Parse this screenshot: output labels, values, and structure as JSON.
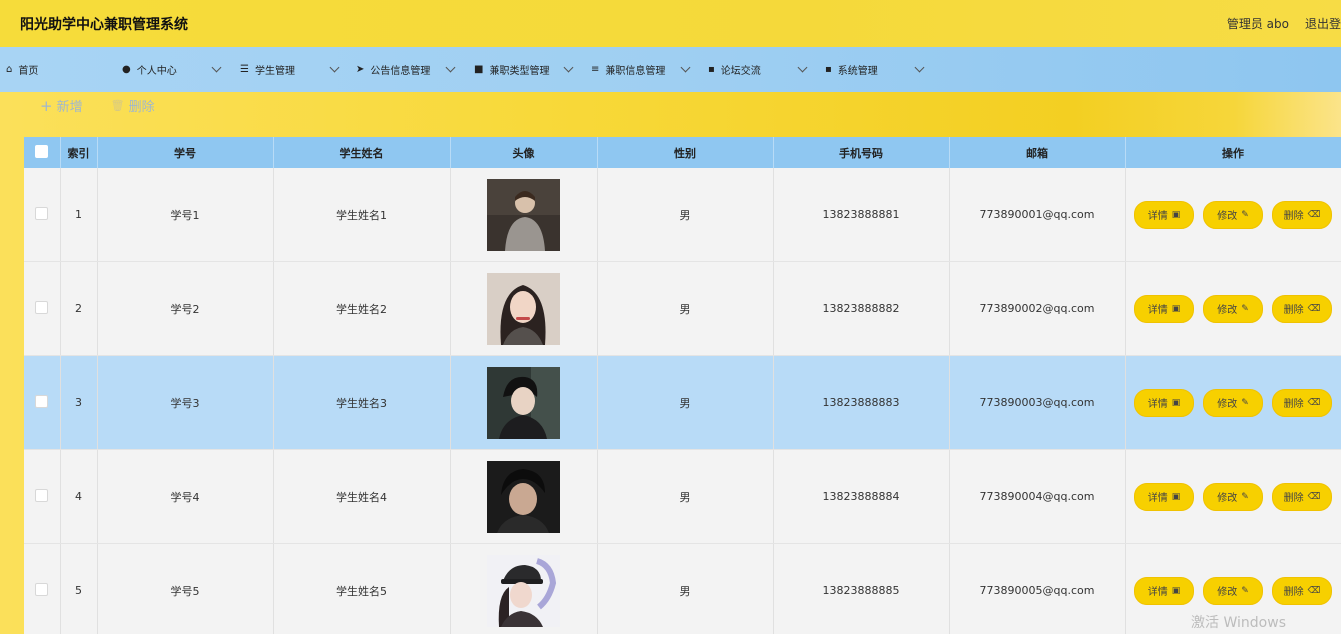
{
  "app": {
    "title": "阳光助学中心兼职管理系统",
    "user_label": "管理员 abo",
    "logout_label": "退出登"
  },
  "nav": [
    {
      "label": "首页",
      "icon": "home-icon",
      "glyph": "⌂",
      "has_dropdown": false
    },
    {
      "label": "个人中心",
      "icon": "user-icon",
      "glyph": "●",
      "has_dropdown": true
    },
    {
      "label": "学生管理",
      "icon": "sliders-icon",
      "glyph": "☰",
      "has_dropdown": true
    },
    {
      "label": "公告信息管理",
      "icon": "send-icon",
      "glyph": "➤",
      "has_dropdown": true
    },
    {
      "label": "兼职类型管理",
      "icon": "save-icon",
      "glyph": "■",
      "has_dropdown": true
    },
    {
      "label": "兼职信息管理",
      "icon": "list-icon",
      "glyph": "≡",
      "has_dropdown": true
    },
    {
      "label": "论坛交流",
      "icon": "grid-icon",
      "glyph": "▪",
      "has_dropdown": true
    },
    {
      "label": "系统管理",
      "icon": "grid-icon",
      "glyph": "▪",
      "has_dropdown": true
    }
  ],
  "toolbar": {
    "add_label": "新增",
    "delete_label": "删除",
    "add_glyph": "+",
    "delete_glyph": "🗑"
  },
  "table": {
    "headers": [
      "索引",
      "学号",
      "学生姓名",
      "头像",
      "性别",
      "手机号码",
      "邮箱",
      "操作"
    ],
    "rows": [
      {
        "index": "1",
        "student_id": "学号1",
        "name": "学生姓名1",
        "gender": "男",
        "phone": "13823888881",
        "email": "773890001@qq.com",
        "avatar": "avatar-1"
      },
      {
        "index": "2",
        "student_id": "学号2",
        "name": "学生姓名2",
        "gender": "男",
        "phone": "13823888882",
        "email": "773890002@qq.com",
        "avatar": "avatar-2"
      },
      {
        "index": "3",
        "student_id": "学号3",
        "name": "学生姓名3",
        "gender": "男",
        "phone": "13823888883",
        "email": "773890003@qq.com",
        "avatar": "avatar-3"
      },
      {
        "index": "4",
        "student_id": "学号4",
        "name": "学生姓名4",
        "gender": "男",
        "phone": "13823888884",
        "email": "773890004@qq.com",
        "avatar": "avatar-4"
      },
      {
        "index": "5",
        "student_id": "学号5",
        "name": "学生姓名5",
        "gender": "男",
        "phone": "13823888885",
        "email": "773890005@qq.com",
        "avatar": "avatar-5"
      }
    ],
    "actions": {
      "detail": "详情",
      "edit": "修改",
      "delete": "删除"
    },
    "selected_row_index": "3"
  },
  "watermark": "激活 Windows",
  "colors": {
    "header_bar": "#f6dc3a",
    "nav_bar": "#9fcff2",
    "table_header": "#8fc7f1",
    "action_button": "#f7d000",
    "selected_row": "#b8dbf7"
  }
}
